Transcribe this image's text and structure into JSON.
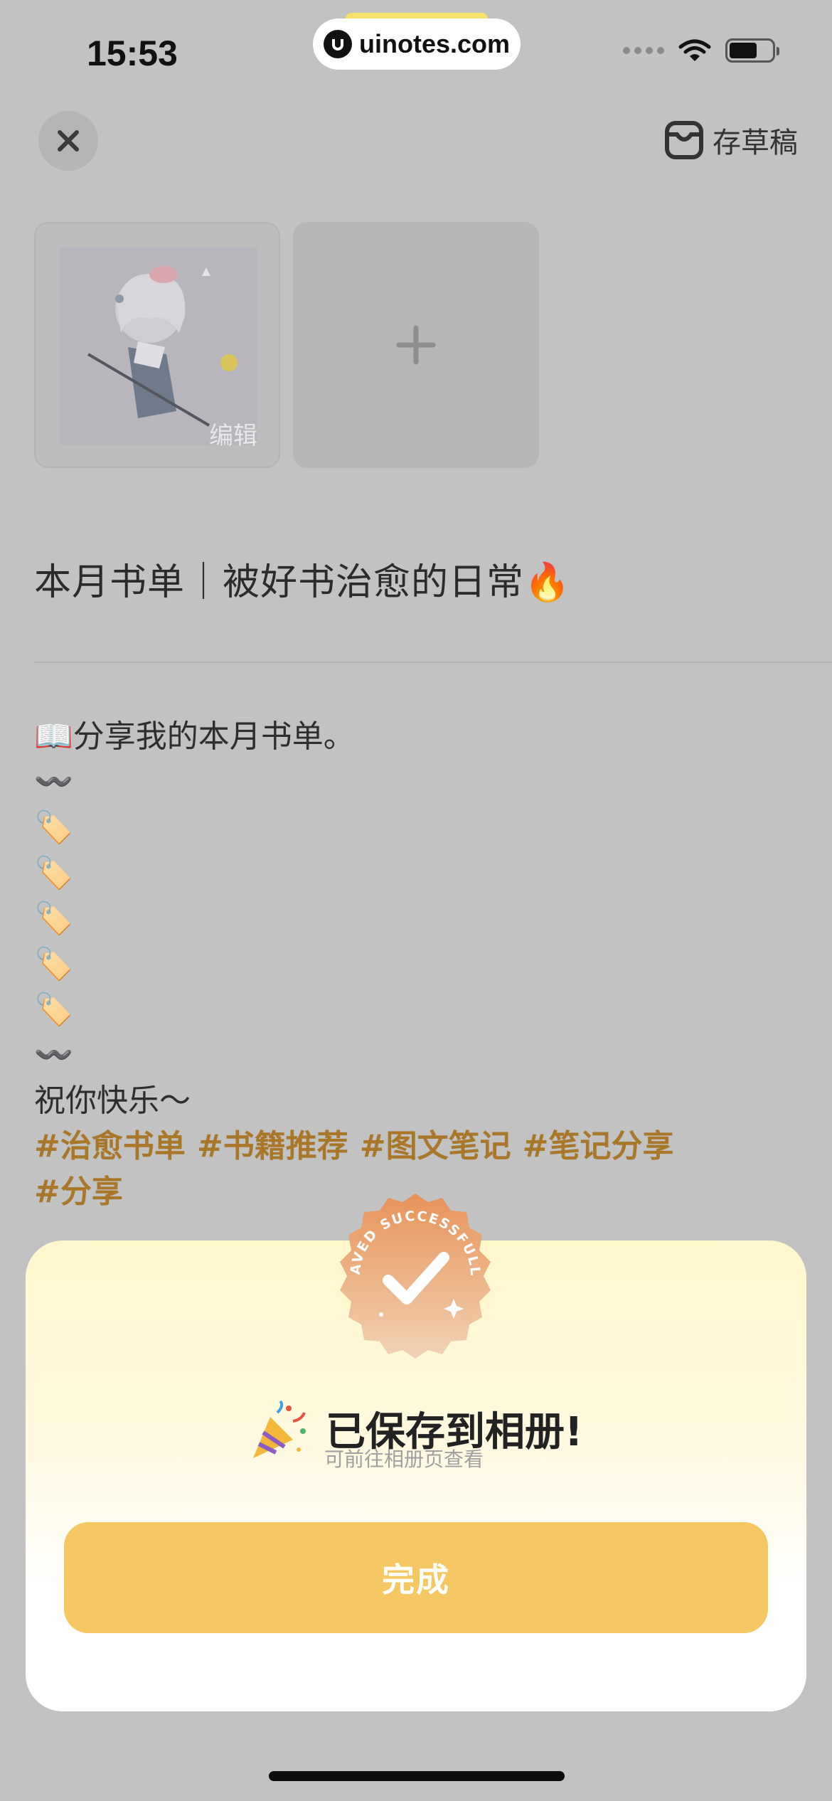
{
  "status_bar": {
    "time": "15:53",
    "watermark": "uinotes.com"
  },
  "header": {
    "close_icon": "close-icon",
    "draft_label": "存草稿"
  },
  "media": {
    "edit_label": "编辑",
    "add_icon": "plus-icon"
  },
  "post": {
    "title": "本月书单｜被好书治愈的日常🔥",
    "body_lines": [
      "📖分享我的本月书单。",
      "〰️",
      "🏷️",
      "🏷️",
      "🏷️",
      "🏷️",
      "🏷️",
      "〰️",
      "祝你快乐～"
    ],
    "tags_line1": [
      "#治愈书单",
      "#书籍推荐",
      "#图文笔记",
      "#笔记分享"
    ],
    "tags_line2": [
      "#分享"
    ]
  },
  "modal": {
    "badge_text": "SAVED SUCCESSFULLY",
    "title": "已保存到相册!",
    "subtitle": "可前往相册页查看",
    "done_label": "完成"
  },
  "colors": {
    "tag": "#a9772a",
    "button": "#f5c863",
    "badge_orange": "#e8935a"
  }
}
